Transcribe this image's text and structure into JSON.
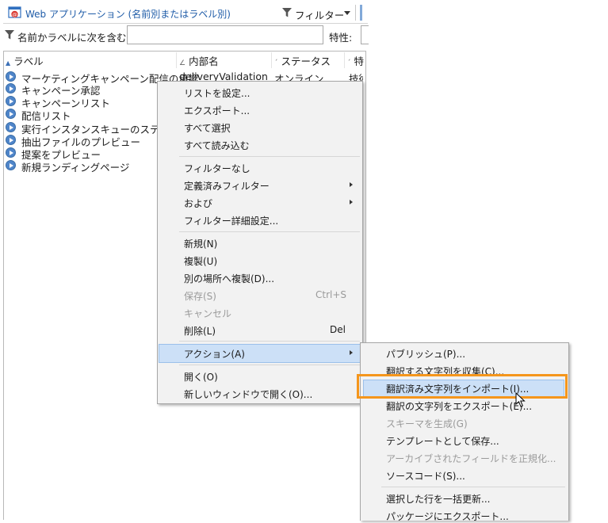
{
  "titlebar": {
    "title": "Web アプリケーション (名前別またはラベル別)",
    "filter_label": "フィルター",
    "icons": {
      "app": "web-app-icon",
      "filter": "funnel-icon",
      "dropdown": "chevron-down-icon"
    }
  },
  "search": {
    "label": "名前かラベルに次を含む:",
    "value": "",
    "attribute_label": "特性:"
  },
  "list": {
    "columns": [
      {
        "label": "ラベル",
        "sort": "ascending"
      },
      {
        "label": "内部名"
      },
      {
        "label": "ステータス"
      },
      {
        "label": "特"
      }
    ],
    "rows": [
      {
        "label": "マーケティングキャンペーン配信の承認",
        "internal_name": "deliveryValidation",
        "status": "オンライン",
        "extra": "技術"
      },
      {
        "label": "キャンペーン承認"
      },
      {
        "label": "キャンペーンリスト"
      },
      {
        "label": "配信リスト"
      },
      {
        "label": "実行インスタンスキューのステータス"
      },
      {
        "label": "抽出ファイルのプレビュー"
      },
      {
        "label": "提案をプレビュー"
      },
      {
        "label": "新規ランディングページ"
      }
    ],
    "row_icon": "play-circle-icon"
  },
  "context_menu": {
    "items": [
      {
        "label": "リストを設定..."
      },
      {
        "label": "エクスポート..."
      },
      {
        "label": "すべて選択"
      },
      {
        "label": "すべて読み込む"
      },
      {
        "label": "フィルターなし"
      },
      {
        "label": "定義済みフィルター"
      },
      {
        "label": "および"
      },
      {
        "label": "フィルター詳細設定..."
      },
      {
        "label": "新規(N)"
      },
      {
        "label": "複製(U)"
      },
      {
        "label": "別の場所へ複製(D)..."
      },
      {
        "label": "保存(S)",
        "shortcut": "Ctrl+S"
      },
      {
        "label": "キャンセル"
      },
      {
        "label": "削除(L)",
        "shortcut": "Del"
      },
      {
        "label": "アクション(A)"
      },
      {
        "label": "開く(O)"
      },
      {
        "label": "新しいウィンドウで開く(O)..."
      }
    ]
  },
  "action_submenu": {
    "items": [
      {
        "label": "パブリッシュ(P)..."
      },
      {
        "label": "翻訳する文字列を収集(C)..."
      },
      {
        "label": "翻訳済み文字列をインポート(I)..."
      },
      {
        "label": "翻訳の文字列をエクスポート(E)..."
      },
      {
        "label": "スキーマを生成(G)"
      },
      {
        "label": "テンプレートとして保存..."
      },
      {
        "label": "アーカイブされたフィールドを正規化..."
      },
      {
        "label": "ソースコード(S)..."
      },
      {
        "label": "選択した行を一括更新..."
      },
      {
        "label": "パッケージにエクスポート..."
      }
    ]
  },
  "colors": {
    "highlight": "#cce0f7",
    "callout": "#f5961c",
    "title_blue": "#1f5ca8"
  }
}
